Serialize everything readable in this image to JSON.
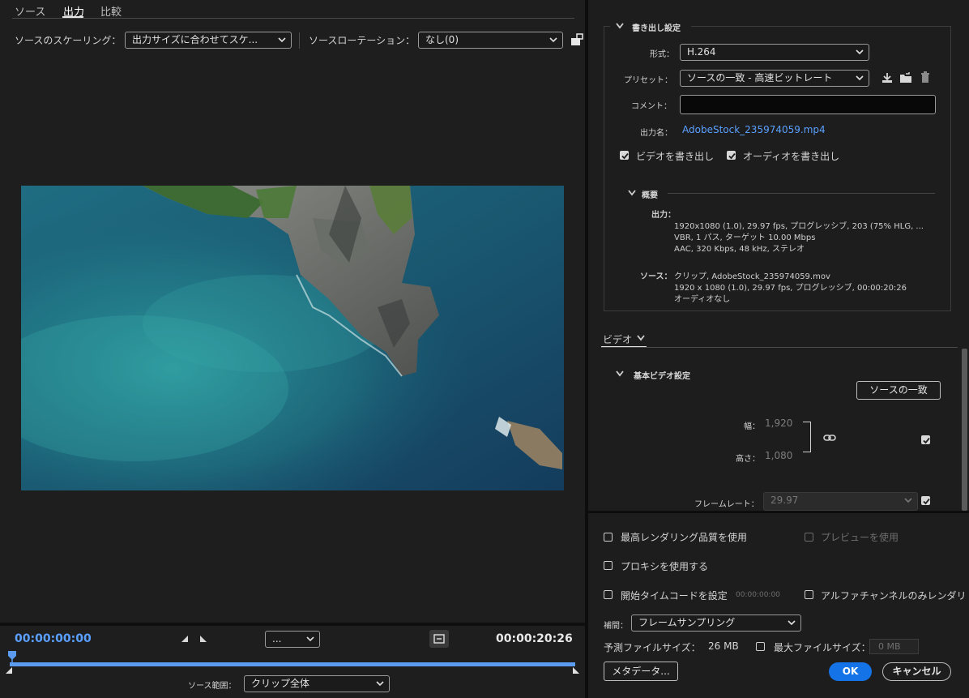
{
  "tabs": [
    "ソース",
    "出力",
    "比較"
  ],
  "source_scaling": {
    "label": "ソースのスケーリング：",
    "value": "出力サイズに合わせてスケ..."
  },
  "source_rotation": {
    "label": "ソースローテーション：",
    "value": "なし(0)"
  },
  "timeline": {
    "current_time": "00:00:00:00",
    "end_time": "00:00:20:26",
    "zoom_value": "...",
    "source_range_label": "ソース範囲：",
    "source_range_value": "クリップ全体",
    "progress": 1.0
  },
  "export_settings": {
    "title": "書き出し設定",
    "format_label": "形式：",
    "format_value": "H.264",
    "preset_label": "プリセット：",
    "preset_value": "ソースの一致 - 高速ビットレート",
    "comment_label": "コメント：",
    "comment_value": "",
    "output_name_label": "出力名：",
    "output_name_value": "AdobeStock_235974059.mp4",
    "export_video_label": "ビデオを書き出し",
    "export_audio_label": "オーディオを書き出し",
    "export_video_checked": true,
    "export_audio_checked": true
  },
  "summary": {
    "title": "概要",
    "output_label": "出力：",
    "output_lines": [
      "1920x1080 (1.0), 29.97 fps, プログレッシブ, 203 (75% HLG, ...",
      "VBR, 1 パス, ターゲット 10.00 Mbps",
      "AAC, 320 Kbps, 48 kHz, ステレオ"
    ],
    "source_label": "ソース：",
    "source_lines": [
      "クリップ, AdobeStock_235974059.mov",
      "1920 x 1080 (1.0), 29.97 fps, プログレッシブ, 00:00:20:26",
      "オーディオなし"
    ]
  },
  "video_tab": {
    "tab_label": "ビデオ",
    "basic_title": "基本ビデオ設定",
    "match_source_button": "ソースの一致",
    "width_label": "幅：",
    "width_value": "1,920",
    "height_label": "高さ：",
    "height_value": "1,080",
    "frame_rate_label": "フレームレート：",
    "frame_rate_value": "29.97"
  },
  "bottom_options": {
    "max_render_quality": "最高レンダリング品質を使用",
    "use_previews": "プレビューを使用",
    "use_proxies": "プロキシを使用する",
    "start_timecode": "開始タイムコードを設定",
    "start_timecode_value": "00:00:00:00",
    "alpha_only": "アルファチャンネルのみレンダリ",
    "interpolation_label": "補間：",
    "interpolation_value": "フレームサンプリング",
    "estimated_size_label": "予測ファイルサイズ：",
    "estimated_size_value": "26 MB",
    "max_file_size_label": "最大ファイルサイズ：",
    "max_file_size_value": "0 MB"
  },
  "buttons": {
    "metadata": "メタデータ...",
    "ok": "OK",
    "cancel": "キャンセル"
  },
  "colors": {
    "accent_blue": "#5aa0ff",
    "ok_button": "#1473e6",
    "panel_bg": "#1d1d1d",
    "timeline_bar": "#5b9bf0"
  }
}
